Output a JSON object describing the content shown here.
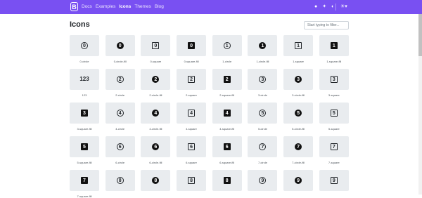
{
  "navbar": {
    "brand": "B",
    "links": [
      "Docs",
      "Examples",
      "Icons",
      "Themes",
      "Blog"
    ],
    "active": "Icons",
    "icons": [
      "github-icon",
      "twitter-icon",
      "opencollective-icon"
    ],
    "theme_toggle": "☀▾"
  },
  "page": {
    "title": "Icons",
    "search_placeholder": "Start typing to filter..."
  },
  "icons": [
    {
      "name": "0-circle",
      "glyph": "0",
      "style": "circle"
    },
    {
      "name": "0-circle-fill",
      "glyph": "0",
      "style": "circle-fill"
    },
    {
      "name": "0-square",
      "glyph": "0",
      "style": "square"
    },
    {
      "name": "0-square-fill",
      "glyph": "0",
      "style": "square-fill"
    },
    {
      "name": "1-circle",
      "glyph": "1",
      "style": "circle"
    },
    {
      "name": "1-circle-fill",
      "glyph": "1",
      "style": "circle-fill"
    },
    {
      "name": "1-square",
      "glyph": "1",
      "style": "square"
    },
    {
      "name": "1-square-fill",
      "glyph": "1",
      "style": "square-fill"
    },
    {
      "name": "123",
      "glyph": "123",
      "style": "text"
    },
    {
      "name": "2-circle",
      "glyph": "2",
      "style": "circle"
    },
    {
      "name": "2-circle-fill",
      "glyph": "2",
      "style": "circle-fill"
    },
    {
      "name": "2-square",
      "glyph": "2",
      "style": "square"
    },
    {
      "name": "2-square-fill",
      "glyph": "2",
      "style": "square-fill"
    },
    {
      "name": "3-circle",
      "glyph": "3",
      "style": "circle"
    },
    {
      "name": "3-circle-fill",
      "glyph": "3",
      "style": "circle-fill"
    },
    {
      "name": "3-square",
      "glyph": "3",
      "style": "square"
    },
    {
      "name": "3-square-fill",
      "glyph": "3",
      "style": "square-fill"
    },
    {
      "name": "4-circle",
      "glyph": "4",
      "style": "circle"
    },
    {
      "name": "4-circle-fill",
      "glyph": "4",
      "style": "circle-fill"
    },
    {
      "name": "4-square",
      "glyph": "4",
      "style": "square"
    },
    {
      "name": "4-square-fill",
      "glyph": "4",
      "style": "square-fill"
    },
    {
      "name": "5-circle",
      "glyph": "5",
      "style": "circle"
    },
    {
      "name": "5-circle-fill",
      "glyph": "5",
      "style": "circle-fill"
    },
    {
      "name": "5-square",
      "glyph": "5",
      "style": "square"
    },
    {
      "name": "5-square-fill",
      "glyph": "5",
      "style": "square-fill"
    },
    {
      "name": "6-circle",
      "glyph": "6",
      "style": "circle"
    },
    {
      "name": "6-circle-fill",
      "glyph": "6",
      "style": "circle-fill"
    },
    {
      "name": "6-square",
      "glyph": "6",
      "style": "square"
    },
    {
      "name": "6-square-fill",
      "glyph": "6",
      "style": "square-fill"
    },
    {
      "name": "7-circle",
      "glyph": "7",
      "style": "circle"
    },
    {
      "name": "7-circle-fill",
      "glyph": "7",
      "style": "circle-fill"
    },
    {
      "name": "7-square",
      "glyph": "7",
      "style": "square"
    },
    {
      "name": "7-square-fill",
      "glyph": "7",
      "style": "square-fill"
    },
    {
      "name": "",
      "glyph": "8",
      "style": "circle"
    },
    {
      "name": "",
      "glyph": "8",
      "style": "circle-fill"
    },
    {
      "name": "",
      "glyph": "8",
      "style": "square"
    },
    {
      "name": "",
      "glyph": "8",
      "style": "square-fill"
    },
    {
      "name": "",
      "glyph": "9",
      "style": "circle"
    },
    {
      "name": "",
      "glyph": "9",
      "style": "circle-fill"
    },
    {
      "name": "",
      "glyph": "9",
      "style": "square"
    }
  ],
  "colors": {
    "navbar": "#7950f2",
    "tile": "#e9ecef",
    "glyph": "#212529"
  }
}
